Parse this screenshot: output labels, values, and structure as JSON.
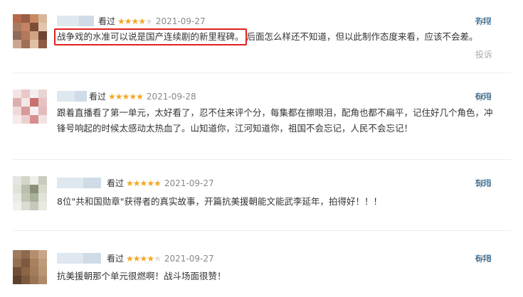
{
  "comments": [
    {
      "status": "看过",
      "rating": 4,
      "date": "2021-09-27",
      "votes": "747",
      "useful": "有用",
      "text_highlight": "战争戏的水准可以说是国产连续剧的新里程碑。",
      "text_rest": "后面怎么样还不知道，但以此制作态度来看，应该不会差。",
      "report": "投诉",
      "avatar_colors": [
        "#b5694a",
        "#9a5d45",
        "#c98a63",
        "#d7b79b",
        "#a87a5e",
        "#c48363",
        "#7d4d38",
        "#e2c6ad",
        "#8f6a58",
        "#b3795c",
        "#d2a484",
        "#6e4433",
        "#caa88f",
        "#a06f55",
        "#e0c0a6",
        "#8c5a44"
      ]
    },
    {
      "status": "看过",
      "rating": 5,
      "date": "2021-09-28",
      "votes": "669",
      "useful": "有用",
      "text": "跟着直播看了第一单元，太好看了，忍不住来评个分，每集都在擦眼泪，配角也都不扁平，记住好几个角色，冲锋号响起的时候太感动太热血了。山知道你，江河知道你，祖国不会忘记，人民不会忘记！",
      "avatar_colors": [
        "#f2e4e4",
        "#e9c8c8",
        "#f5eeee",
        "#ead3d3",
        "#dcb0b0",
        "#f3e7e7",
        "#c97070",
        "#e6c3c3",
        "#f0d9d9",
        "#d99a9a",
        "#f7efef",
        "#e4bcbc",
        "#f6eaea",
        "#ecd0d0",
        "#d88e8e",
        "#f1e2e2"
      ]
    },
    {
      "status": "看过",
      "rating": 5,
      "date": "2021-09-27",
      "votes": "585",
      "useful": "有用",
      "text": "8位\"共和国勋章\"获得者的真实故事，开篇抗美援朝能文能武李延年，拍得好！！！",
      "avatar_colors": [
        "#e6e6e0",
        "#d3d6c8",
        "#eeeeea",
        "#c8ccbd",
        "#dfe2d6",
        "#b9bfae",
        "#8a9178",
        "#d6d9cc",
        "#eaeae6",
        "#c2c7b5",
        "#a9b09a",
        "#e1e3da",
        "#f0f0ec",
        "#d9dcd1",
        "#c5c9b9",
        "#e8e9e3"
      ]
    },
    {
      "status": "看过",
      "rating": 4,
      "date": "2021-09-27",
      "votes": "648",
      "useful": "有用",
      "text": "抗美援朝那个单元很燃啊！战斗场面很赞！",
      "avatar_colors": [
        "#a07a5c",
        "#8c6a50",
        "#b58e6e",
        "#c9a588",
        "#94704f",
        "#7b5a40",
        "#a8825f",
        "#bf9a7a",
        "#6f4f38",
        "#8a6548",
        "#a37c5b",
        "#b99574",
        "#5e412c",
        "#7c5a3f",
        "#9a7455",
        "#af8a69"
      ]
    }
  ]
}
